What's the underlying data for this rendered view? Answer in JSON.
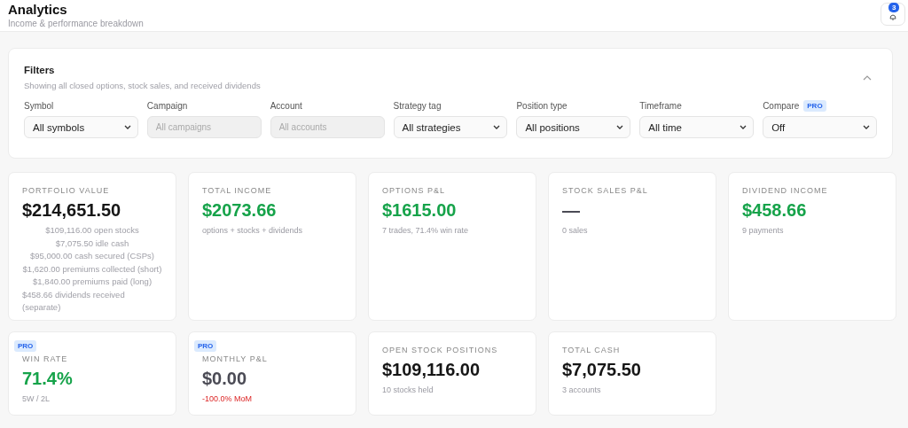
{
  "header": {
    "title": "Analytics",
    "subtitle": "Income & performance breakdown",
    "notifications": {
      "count": "3"
    }
  },
  "filters": {
    "title": "Filters",
    "description": "Showing all closed options, stock sales, and received dividends",
    "expanded": true,
    "fields": [
      {
        "label": "Symbol",
        "value": "All symbols",
        "disabled": false
      },
      {
        "label": "Campaign",
        "placeholder": "All campaigns",
        "disabled": true
      },
      {
        "label": "Account",
        "placeholder": "All accounts",
        "disabled": true
      },
      {
        "label": "Strategy tag",
        "value": "All strategies",
        "disabled": false
      },
      {
        "label": "Position type",
        "value": "All positions",
        "disabled": false
      },
      {
        "label": "Timeframe",
        "value": "All time",
        "disabled": false
      },
      {
        "label": "Compare",
        "badge": "PRO",
        "value": "Off",
        "disabled": false
      }
    ]
  },
  "cards": [
    {
      "title": "PORTFOLIO VALUE",
      "value": "$214,651.50",
      "color": "#161616",
      "lines": [
        "$109,116.00 open stocks",
        "$7,075.50 idle cash",
        "$95,000.00 cash secured (CSPs)",
        "$1,620.00 premiums collected (short)",
        "$1,840.00 premiums paid (long)",
        "$458.66 dividends received (separate)"
      ]
    },
    {
      "title": "TOTAL INCOME",
      "value": "$2073.66",
      "color": "#16a34a",
      "note": "options + stocks + dividends",
      "note_negative": false
    },
    {
      "title": "OPTIONS P&L",
      "value": "$1615.00",
      "color": "#16a34a",
      "note": "7 trades, 71.4% win rate",
      "note_negative": false
    },
    {
      "title": "STOCK SALES P&L",
      "value": "—",
      "color": "#4b4b55",
      "note": "0 sales",
      "note_negative": false
    },
    {
      "title": "DIVIDEND INCOME",
      "value": "$458.66",
      "color": "#16a34a",
      "note": "9 payments",
      "note_negative": false
    },
    {
      "badge": "PRO",
      "title": "WIN RATE",
      "value": "71.4%",
      "color": "#16a34a",
      "note": "5W / 2L",
      "note_negative": false
    },
    {
      "badge": "PRO",
      "title": "MONTHLY P&L",
      "value": "$0.00",
      "color": "#4b4b55",
      "note": "-100.0% MoM",
      "note_negative": true
    },
    {
      "title": "OPEN STOCK POSITIONS",
      "value": "$109,116.00",
      "color": "#161616",
      "note": "10 stocks held",
      "note_negative": false
    },
    {
      "title": "TOTAL CASH",
      "value": "$7,075.50",
      "color": "#161616",
      "note": "3 accounts",
      "note_negative": false
    }
  ]
}
